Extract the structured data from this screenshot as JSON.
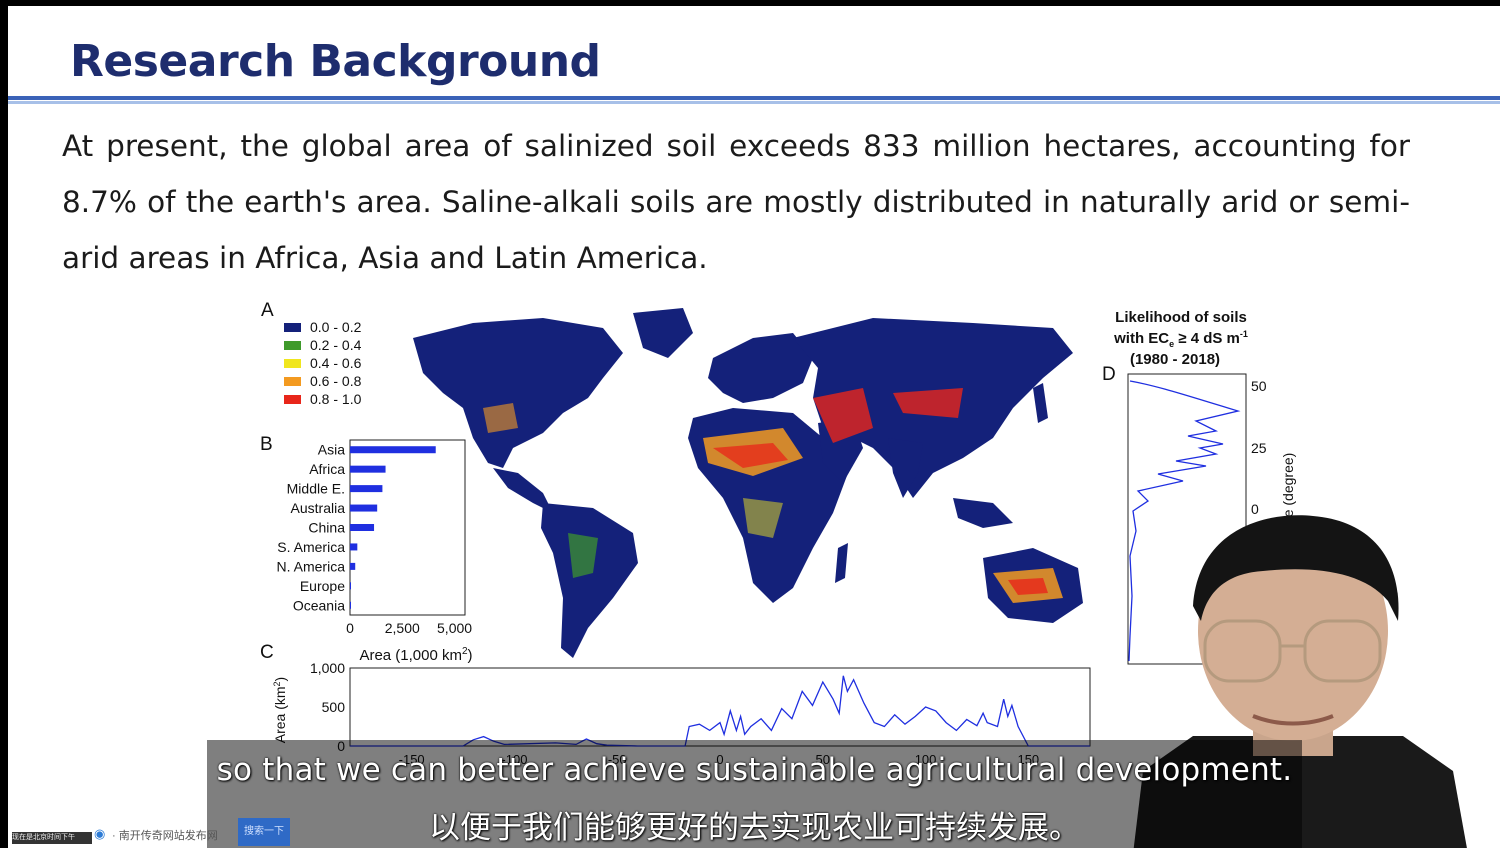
{
  "slide": {
    "title": "Research Background",
    "paragraph": "At present, the global area of salinized soil exceeds 833 million hectares, accounting for 8.7% of the earth's area. Saline-alkali soils are mostly distributed in naturally arid or semi-arid areas in Africa, Asia and Latin America."
  },
  "figure": {
    "panel_a_letter": "A",
    "panel_b_letter": "B",
    "panel_c_letter": "C",
    "panel_d_letter": "D",
    "legend": [
      {
        "label": "0.0 - 0.2",
        "color": "#14217a"
      },
      {
        "label": "0.2 - 0.4",
        "color": "#3f9a2b"
      },
      {
        "label": "0.4 - 0.6",
        "color": "#f0e61e"
      },
      {
        "label": "0.6 - 0.8",
        "color": "#f39a20"
      },
      {
        "label": "0.8 - 1.0",
        "color": "#e8261a"
      }
    ],
    "panel_d_title_line1": "Likelihood of soils",
    "panel_d_title_line2": "with EC",
    "panel_d_title_sub": "e",
    "panel_d_title_line2b": " ≥ 4 dS m",
    "panel_d_title_sup": "-1",
    "panel_d_title_line3": "(1980 - 2018)"
  },
  "chart_data": [
    {
      "type": "bar",
      "panel": "B",
      "categories": [
        "Asia",
        "Africa",
        "Middle E.",
        "Australia",
        "China",
        "S. America",
        "N. America",
        "Europe",
        "Oceania"
      ],
      "values": [
        4100,
        1700,
        1550,
        1300,
        1150,
        350,
        250,
        40,
        20
      ],
      "xticks": [
        "0",
        "2,500",
        "5,000"
      ],
      "xlim": [
        0,
        5500
      ],
      "xlabel": "Area (1,000 km",
      "xlabel_sup": "2",
      "xlabel_end": ")",
      "orientation": "horizontal",
      "color": "#1f2fe0"
    },
    {
      "type": "line",
      "panel": "C",
      "ylabel": "Area (km",
      "ylabel_sup": "2",
      "ylabel_end": ")",
      "yticks": [
        "0",
        "500",
        "1,000"
      ],
      "xticks": [
        "-150",
        "-100",
        "-50",
        "0",
        "50",
        "100",
        "150"
      ],
      "ylim": [
        0,
        1000
      ],
      "xlim": [
        -180,
        180
      ],
      "x": [
        -180,
        -125,
        -120,
        -115,
        -110,
        -105,
        -80,
        -70,
        -65,
        -60,
        -55,
        -40,
        -17,
        -15,
        -10,
        -5,
        0,
        2,
        5,
        8,
        10,
        12,
        15,
        20,
        25,
        30,
        35,
        40,
        45,
        50,
        55,
        58,
        60,
        62,
        65,
        70,
        75,
        80,
        85,
        90,
        95,
        100,
        105,
        110,
        115,
        120,
        125,
        128,
        130,
        135,
        138,
        140,
        142,
        145,
        150,
        155,
        160,
        180
      ],
      "values": [
        0,
        0,
        80,
        120,
        60,
        20,
        40,
        20,
        90,
        30,
        10,
        0,
        0,
        250,
        280,
        200,
        300,
        150,
        450,
        200,
        380,
        150,
        250,
        350,
        200,
        480,
        350,
        700,
        520,
        820,
        600,
        420,
        900,
        700,
        850,
        550,
        300,
        250,
        400,
        280,
        380,
        500,
        450,
        300,
        200,
        340,
        260,
        420,
        300,
        250,
        600,
        380,
        520,
        250,
        0,
        0,
        0,
        0
      ],
      "color": "#1f2fe0"
    },
    {
      "type": "line",
      "panel": "D",
      "ylabel": "Latitude (degree)",
      "yticks": [
        "50",
        "25",
        "0"
      ],
      "ylim": [
        -60,
        60
      ],
      "orientation": "vertical",
      "color": "#1f2fe0"
    }
  ],
  "subtitles": {
    "english": "so that we can better achieve sustainable agricultural development.",
    "chinese": "以便于我们能够更好的去实现农业可持续发展。"
  },
  "taskbar": {
    "thumbnail_text": "现在是北京时间下午",
    "site_text": "· 南开传奇网站发布网",
    "button_label": "搜索一下"
  }
}
